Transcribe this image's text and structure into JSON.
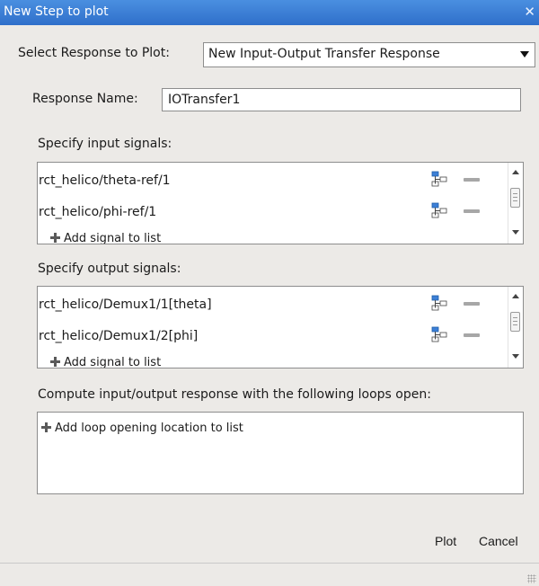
{
  "window": {
    "title": "New Step to plot",
    "close_glyph": "✕"
  },
  "select_response": {
    "label": "Select Response to Plot:",
    "value": "New Input-Output Transfer Response"
  },
  "response_name": {
    "label": "Response Name:",
    "value": "IOTransfer1"
  },
  "inputs": {
    "label": "Specify input signals:",
    "items": [
      "rct_helico/theta-ref/1",
      "rct_helico/phi-ref/1"
    ],
    "add_label": "Add signal to list"
  },
  "outputs": {
    "label": "Specify output signals:",
    "items": [
      "rct_helico/Demux1/1[theta]",
      "rct_helico/Demux1/2[phi]"
    ],
    "add_label": "Add signal to list"
  },
  "loops": {
    "label": "Compute input/output response with the following loops open:",
    "add_label": "Add loop opening location to list"
  },
  "buttons": {
    "plot": "Plot",
    "cancel": "Cancel"
  },
  "icons": {
    "signal": "signal-selector-icon",
    "remove": "remove-icon",
    "add": "add-icon",
    "accent": "#3c7fd6"
  }
}
